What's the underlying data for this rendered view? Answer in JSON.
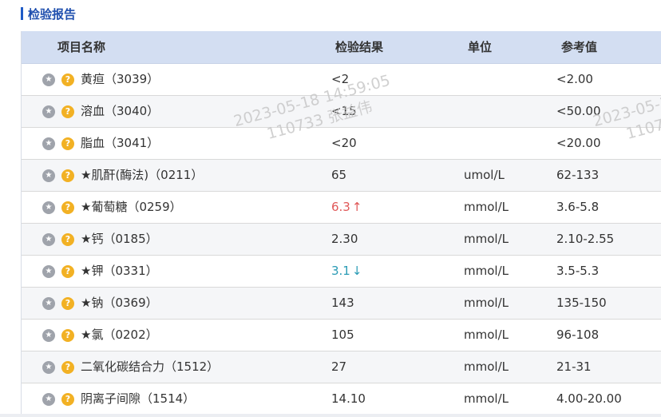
{
  "section": {
    "title": "检验报告"
  },
  "table": {
    "columns": [
      "项目名称",
      "检验结果",
      "单位",
      "参考值"
    ],
    "rows": [
      {
        "name": "黄疸（3039）",
        "result": "<2",
        "flag": "",
        "unit": "",
        "ref": "<2.00"
      },
      {
        "name": "溶血（3040）",
        "result": "<15",
        "flag": "",
        "unit": "",
        "ref": "<50.00"
      },
      {
        "name": "脂血（3041）",
        "result": "<20",
        "flag": "",
        "unit": "",
        "ref": "<20.00"
      },
      {
        "name": "★肌酐(酶法)（0211）",
        "result": "65",
        "flag": "",
        "unit": "umol/L",
        "ref": "62-133"
      },
      {
        "name": "★葡萄糖（0259）",
        "result": "6.3",
        "flag": "↑",
        "unit": "mmol/L",
        "ref": "3.6-5.8"
      },
      {
        "name": "★钙（0185）",
        "result": "2.30",
        "flag": "",
        "unit": "mmol/L",
        "ref": "2.10-2.55"
      },
      {
        "name": "★钾（0331）",
        "result": "3.1",
        "flag": "↓",
        "unit": "mmol/L",
        "ref": "3.5-5.3"
      },
      {
        "name": "★钠（0369）",
        "result": "143",
        "flag": "",
        "unit": "mmol/L",
        "ref": "135-150"
      },
      {
        "name": "★氯（0202）",
        "result": "105",
        "flag": "",
        "unit": "mmol/L",
        "ref": "96-108"
      },
      {
        "name": "二氧化碳结合力（1512）",
        "result": "27",
        "flag": "",
        "unit": "mmol/L",
        "ref": "21-31"
      },
      {
        "name": "阴离子间隙（1514）",
        "result": "14.10",
        "flag": "",
        "unit": "mmol/L",
        "ref": "4.00-20.00"
      }
    ]
  },
  "icons": {
    "star": "star-icon",
    "help": "question-icon"
  },
  "watermark": {
    "line1": "2023-05-18 14:59:05",
    "line2": "110733 张益伟",
    "line1_partial": "2023-05-1",
    "line2_partial": "11073"
  },
  "colors": {
    "header_bg": "#d3def2",
    "high": "#e05858",
    "low": "#2a9bb5",
    "accent": "#1f5bc6"
  }
}
